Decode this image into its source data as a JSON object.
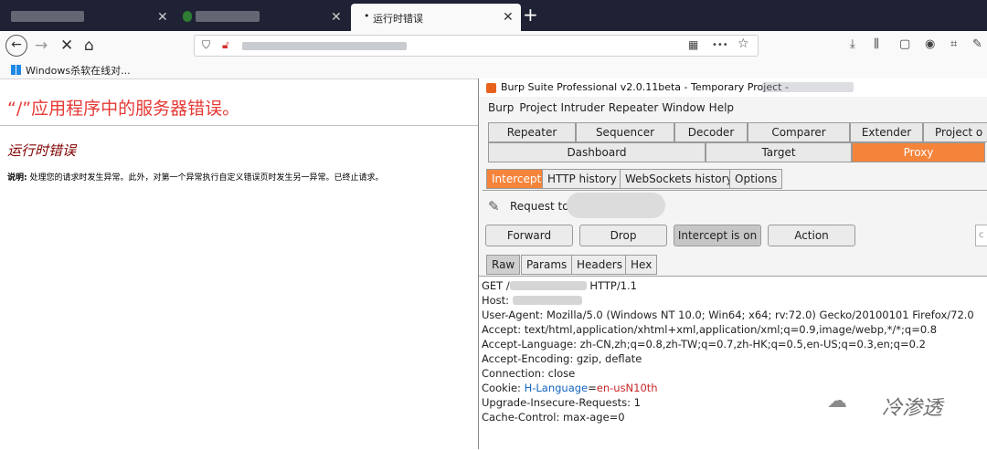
{
  "browser": {
    "tabs": [
      {
        "label": "",
        "active": false
      },
      {
        "label": "",
        "active": false
      },
      {
        "label": "运行时错误",
        "active": true
      }
    ],
    "new_tab": "+",
    "nav": {
      "back": "←",
      "forward": "→",
      "stop": "✕",
      "home": "⌂"
    },
    "toolbar": {
      "more": "•••",
      "star": "☆"
    },
    "bookmark": "Windows杀软在线对..."
  },
  "error_page": {
    "title": "“/”应用程序中的服务器错误。",
    "subtitle": "运行时错误",
    "desc_label": "说明:",
    "desc_text": " 处理您的请求时发生异常。此外，对第一个异常执行自定义错误页时发生另一异常。已终止请求。"
  },
  "burp": {
    "title": "Burp Suite Professional v2.0.11beta - Temporary Project -",
    "menu": [
      "Burp",
      "Project",
      "Intruder",
      "Repeater",
      "Window",
      "Help"
    ],
    "tabs_row1": [
      "Repeater",
      "Sequencer",
      "Decoder",
      "Comparer",
      "Extender",
      "Project o"
    ],
    "tabs_row2": [
      "Dashboard",
      "Target",
      "Proxy"
    ],
    "subtabs": [
      "Intercept",
      "HTTP history",
      "WebSockets history",
      "Options"
    ],
    "request_label": "Request to",
    "buttons": {
      "forward": "Forward",
      "drop": "Drop",
      "intercept": "Intercept is on",
      "action": "Action"
    },
    "request_tabs": [
      "Raw",
      "Params",
      "Headers",
      "Hex"
    ],
    "request": {
      "line1_a": "GET /",
      "line1_b": " HTTP/1.1",
      "host": "Host: ",
      "ua": "User-Agent: Mozilla/5.0 (Windows NT 10.0; Win64; x64; rv:72.0) Gecko/20100101 Firefox/72.0",
      "accept": "Accept: text/html,application/xhtml+xml,application/xml;q=0.9,image/webp,*/*;q=0.8",
      "lang": "Accept-Language: zh-CN,zh;q=0.8,zh-TW;q=0.7,zh-HK;q=0.5,en-US;q=0.3,en;q=0.2",
      "enc": "Accept-Encoding: gzip, deflate",
      "conn": "Connection: close",
      "cookie_key": "Cookie: ",
      "cookie_name": "H-Language",
      "cookie_eq": "=",
      "cookie_val": "en-usN10th",
      "upgrade": "Upgrade-Insecure-Requests: 1",
      "cache": "Cache-Control: max-age=0"
    }
  },
  "watermark": "冷渗透"
}
